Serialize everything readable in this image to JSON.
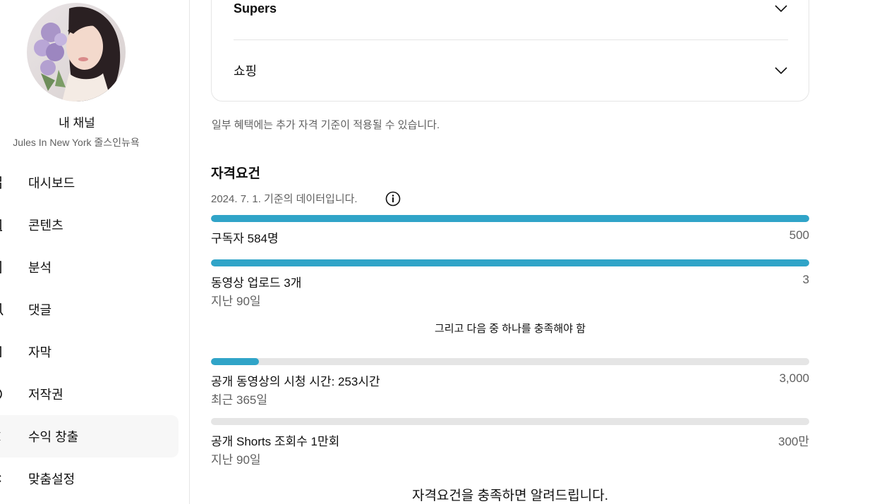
{
  "sidebar": {
    "channel_title": "내 채널",
    "channel_name": "Jules In New York 줄스인뉴욕",
    "items": [
      {
        "label": "대시보드",
        "icon": "dashboard-icon"
      },
      {
        "label": "콘텐츠",
        "icon": "content-icon"
      },
      {
        "label": "분석",
        "icon": "analytics-icon"
      },
      {
        "label": "댓글",
        "icon": "comments-icon"
      },
      {
        "label": "자막",
        "icon": "subtitles-icon"
      },
      {
        "label": "저작권",
        "icon": "copyright-icon"
      },
      {
        "label": "수익 창출",
        "icon": "monetization-icon",
        "active": true
      },
      {
        "label": "맞춤설정",
        "icon": "customization-icon"
      }
    ]
  },
  "benefits": {
    "items": [
      {
        "label": "Supers"
      },
      {
        "label": "쇼핑"
      }
    ],
    "note": "일부 혜택에는 추가 자격 기준이 적용될 수 있습니다."
  },
  "eligibility": {
    "title": "자격요건",
    "data_date": "2024. 7. 1. 기준의 데이터입니다.",
    "requirements": [
      {
        "label": "구독자 584명",
        "target": "500",
        "sub": "",
        "progress": 1.0
      },
      {
        "label": "동영상 업로드 3개",
        "target": "3",
        "sub": "지난 90일",
        "progress": 1.0
      }
    ],
    "and_text": "그리고 다음 중 하나를 충족해야 함",
    "optional": [
      {
        "label": "공개 동영상의 시청 시간: 253시간",
        "target": "3,000",
        "sub": "최근 365일",
        "progress": 0.08
      },
      {
        "label": "공개 Shorts 조회수 1만회",
        "target": "300만",
        "sub": "지난 90일",
        "progress": 0.0
      }
    ],
    "notify_text": "자격요건을 충족하면 알려드립니다."
  },
  "colors": {
    "progress_fill": "#30a4c8",
    "progress_track": "#e5e5e5",
    "active_nav_bg": "#f7f7f7"
  }
}
